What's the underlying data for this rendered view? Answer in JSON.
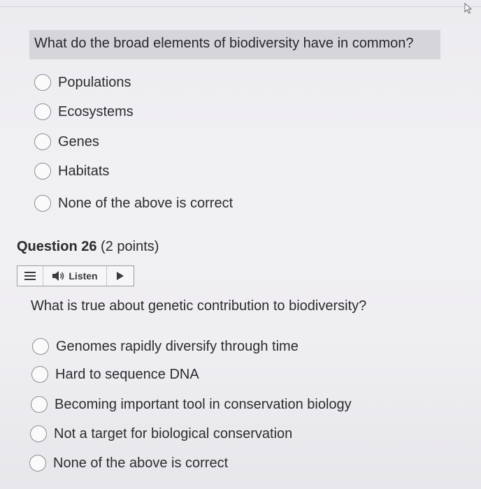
{
  "question_25": {
    "prompt": "What do the broad elements of biodiversity have in common?",
    "options": [
      "Populations",
      "Ecosystems",
      "Genes",
      "Habitats",
      "None of the above is correct"
    ]
  },
  "question_26": {
    "title": "Question 26",
    "points": "(2 points)",
    "listen_label": "Listen",
    "prompt": "What is true about genetic contribution to biodiversity?",
    "options": [
      "Genomes rapidly diversify through time",
      "Hard to sequence DNA",
      "Becoming important tool in conservation biology",
      "Not a target for biological conservation",
      "None of the above is correct"
    ]
  },
  "icons": {
    "cursor": "mouse-pointer-icon",
    "menu": "hamburger-menu-icon",
    "speaker": "speaker-icon",
    "play": "play-icon"
  },
  "colors": {
    "highlight": "#d6d5da",
    "text": "#2b2b2f",
    "radio_border": "#8d8d93"
  }
}
